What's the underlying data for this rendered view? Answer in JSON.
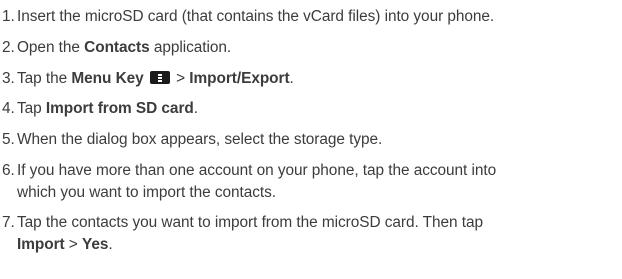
{
  "steps": [
    {
      "num": "1.",
      "text": "Insert the microSD card (that contains the vCard files) into your phone."
    },
    {
      "num": "2.",
      "pre": "Open the ",
      "bold": "Contacts",
      "post": " application."
    },
    {
      "num": "3.",
      "pre": "Tap the ",
      "bold1": "Menu Key",
      "sep": " > ",
      "bold2": "Import/Export",
      "post": "."
    },
    {
      "num": "4.",
      "pre": "Tap ",
      "bold": "Import from SD card",
      "post": "."
    },
    {
      "num": "5.",
      "text": "When the dialog box appears, select the storage type."
    },
    {
      "num": "6.",
      "line1": "If you have more than one account on your phone, tap the account into",
      "line2": "which you want to import the contacts."
    },
    {
      "num": "7.",
      "line1": "Tap the contacts you want to import from the microSD card. Then tap",
      "bold1": "Import",
      "sep": " > ",
      "bold2": "Yes",
      "post": "."
    }
  ],
  "icons": {
    "menu_key": "menu-key-icon"
  },
  "colors": {
    "text": "#3c3c3c",
    "menu_key_bg": "#1b1b1b"
  }
}
